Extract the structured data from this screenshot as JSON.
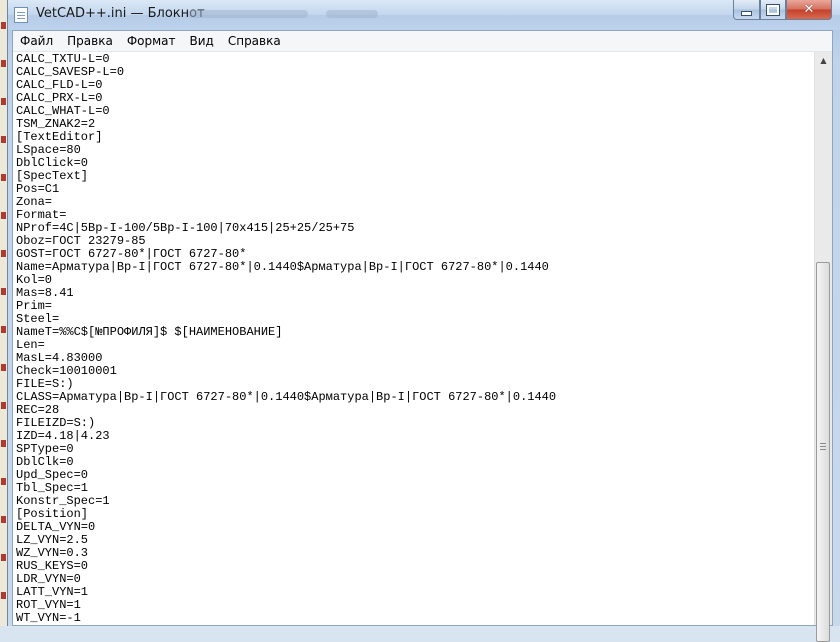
{
  "window": {
    "title": "VetCAD++.ini — Блокнот",
    "close_glyph": "✕"
  },
  "menu": [
    "Файл",
    "Правка",
    "Формат",
    "Вид",
    "Справка"
  ],
  "editor": {
    "lines": [
      "CALC_TXTU-L=0",
      "CALC_SAVESP-L=0",
      "CALC_FLD-L=0",
      "CALC_PRX-L=0",
      "CALC_WHAT-L=0",
      "TSM_ZNAK2=2",
      "[TextEditor]",
      "LSpace=80",
      "DblClick=0",
      "[SpecText]",
      "Pos=C1",
      "Zona=",
      "Format=",
      "NProf=4C|5Bp-I-100/5Bp-I-100|70x415|25+25/25+75",
      "Oboz=ГОСТ 23279-85",
      "GOST=ГОСТ 6727-80*|ГОСТ 6727-80*",
      "Name=Арматура|Bp-I|ГОСТ 6727-80*|0.1440$Арматура|Bp-I|ГОСТ 6727-80*|0.1440",
      "Kol=0",
      "Mas=8.41",
      "Prim=",
      "Steel=",
      "NameT=%%C$[№ПРОФИЛЯ]$ $[НАИМЕНОВАНИЕ]",
      "Len=",
      "MasL=4.83000",
      "Check=10010001",
      "FILE=S:)",
      "CLASS=Арматура|Bp-I|ГОСТ 6727-80*|0.1440$Арматура|Bp-I|ГОСТ 6727-80*|0.1440",
      "REC=28",
      "FILEIZD=S:)",
      "IZD=4.18|4.23",
      "SPType=0",
      "DblClk=0",
      "Upd_Spec=0",
      "Tbl_Spec=1",
      "Konstr_Spec=1",
      "[Position]",
      "DELTA_VYN=0",
      "LZ_VYN=2.5",
      "WZ_VYN=0.3",
      "RUS_KEYS=0",
      "LDR_VYN=0",
      "LATT_VYN=1",
      "ROT_VYN=1",
      "WT_VYN=-1"
    ]
  },
  "scrollbar": {
    "up_glyph": "▲"
  }
}
